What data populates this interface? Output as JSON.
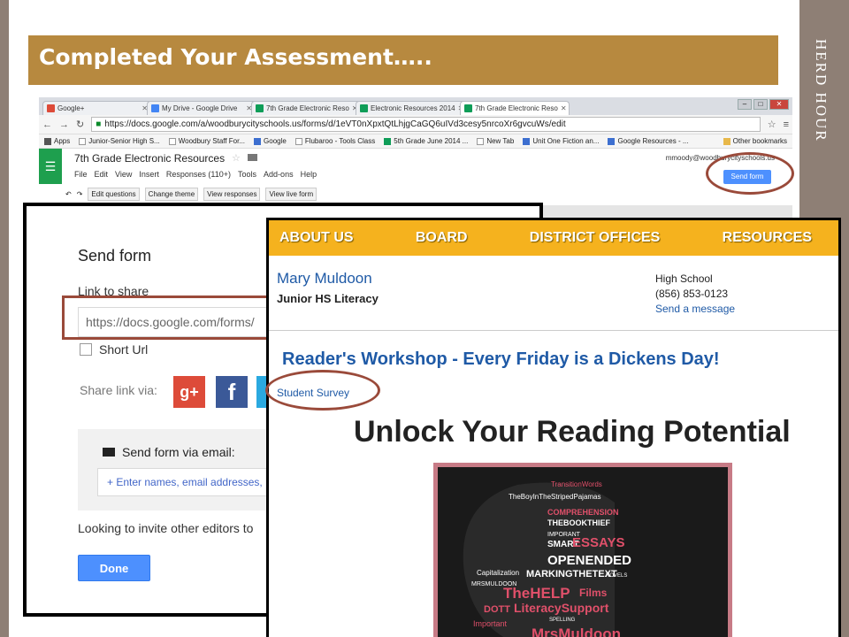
{
  "slide": {
    "title": "Completed Your Assessment…..",
    "side_title": "Herd Hour"
  },
  "browser": {
    "tabs": [
      {
        "label": "Google+",
        "icon": "google-plus-favicon"
      },
      {
        "label": "My Drive - Google Drive",
        "icon": "drive-favicon"
      },
      {
        "label": "7th Grade Electronic Reso",
        "icon": "forms-favicon"
      },
      {
        "label": "Electronic Resources 2014",
        "icon": "sheets-favicon"
      },
      {
        "label": "7th Grade Electronic Reso",
        "icon": "forms-favicon"
      }
    ],
    "url": "https://docs.google.com/a/woodburycityschools.us/forms/d/1eVT0nXpxtQtLhjgCaGQ6uIVd3cesy5nrcoXr6gvcuWs/edit",
    "bookmarks": [
      "Apps",
      "Junior-Senior High S...",
      "Woodbury Staff For...",
      "Google",
      "Flubaroo - Tools Class",
      "5th Grade June 2014 ...",
      "New Tab",
      "Unit One Fiction an...",
      "Google Resources - ...",
      "Other bookmarks"
    ],
    "form": {
      "title": "7th Grade Electronic Resources",
      "menu": [
        "File",
        "Edit",
        "View",
        "Insert",
        "Responses (110+)",
        "Tools",
        "Add-ons",
        "Help"
      ],
      "toolbar": [
        "Edit questions",
        "Change theme",
        "View responses",
        "View live form"
      ],
      "user_email": "mmoody@woodburycityschools.us",
      "send_button": "Send form"
    }
  },
  "dialog": {
    "title": "Send form",
    "link_label": "Link to share",
    "link_value": "https://docs.google.com/forms/",
    "short_url": "Short Url",
    "share_label": "Share link via:",
    "email_label": "Send form via email:",
    "email_placeholder": "+ Enter names, email addresses,",
    "invite_text": "Looking to invite other editors to",
    "done_button": "Done"
  },
  "site": {
    "nav": [
      "ABOUT US",
      "BOARD",
      "DISTRICT OFFICES",
      "RESOURCES"
    ],
    "teacher_name": "Mary Muldoon",
    "teacher_role": "Junior HS Literacy",
    "school": "High School",
    "phone": "(856) 853-0123",
    "message_link": "Send a message",
    "workshop_heading": "Reader's Workshop - Every Friday is a Dickens Day!",
    "survey_link": "Student Survey",
    "unlock_heading": "Unlock Your Reading Potential",
    "word_cloud": [
      "TransitionWords",
      "TheBoyInTheStripedPajamas",
      "COMPREHENSION",
      "THEBOOKTHIEF",
      "IMPORANT",
      "SMART",
      "ESSAYS",
      "OPENENDED",
      "Capitalization",
      "MARKINGTHETEXT",
      "MRSMULDOON",
      "TheHELP",
      "Films",
      "DOTT",
      "LiteracySupport",
      "Important",
      "NOVELS",
      "SPELLING",
      "MrsMuldoon"
    ]
  },
  "colors": {
    "title_bar": "#b7893f",
    "side_band": "#8e7f75",
    "site_nav": "#f5b21e",
    "link_blue": "#1f5aa6",
    "annotation": "#9a4a3a"
  }
}
